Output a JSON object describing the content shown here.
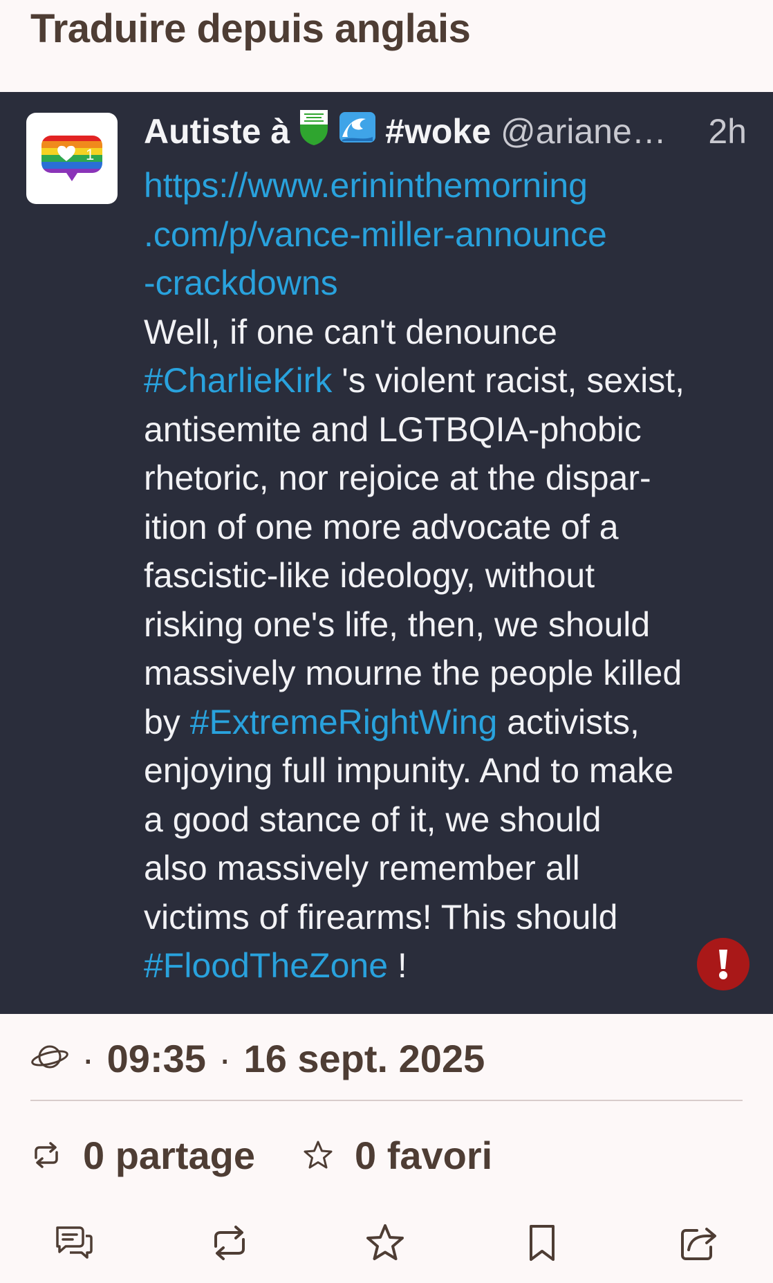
{
  "header": {
    "translate_title": "Traduire depuis anglais"
  },
  "post": {
    "author_name": "Autiste à",
    "author_tag": "#woke",
    "handle": "@ariane…",
    "relative_time": "2h",
    "avatar_icon": "rainbow-heart-notification-icon",
    "body_lines": [
      {
        "link": "https://www.erininthemorning"
      },
      {
        "link": ".com/p/vance-miller-announce"
      },
      {
        "link": "-crackdowns"
      },
      {
        "text": "Well, if one can't denounce"
      },
      {
        "link": "#CharlieKirk",
        "text": " 's violent racist, sexist,"
      },
      {
        "text": "antisemite and LGTBQIA-phobic"
      },
      {
        "text": "rhetoric, nor rejoice at the dispar-"
      },
      {
        "text": "ition of one more advocate of a"
      },
      {
        "text": "fascistic-like ideology, without"
      },
      {
        "text": "risking one's life, then, we should"
      },
      {
        "text": "massively mourne the people killed"
      },
      {
        "pre": "by ",
        "link": "#ExtremeRightWing",
        "text": " activists,"
      },
      {
        "text": "enjoying full impunity. And to make"
      },
      {
        "text": "a good stance of it, we should"
      },
      {
        "text": "also massively remember all"
      },
      {
        "text": "victims of firearms! This should"
      },
      {
        "link": "#FloodTheZone",
        "text": " !"
      }
    ]
  },
  "details": {
    "visibility_icon": "globe-icon",
    "time": "09:35",
    "date": "16 sept. 2025"
  },
  "stats": {
    "boosts": "0 partage",
    "favourites": "0 favori"
  },
  "actions": [
    "reply",
    "boost",
    "favourite",
    "bookmark",
    "share"
  ],
  "colors": {
    "card_bg": "#2a2d3b",
    "link": "#29a2dd",
    "text_brown": "#4e3d34",
    "alert_red": "#a91818"
  }
}
